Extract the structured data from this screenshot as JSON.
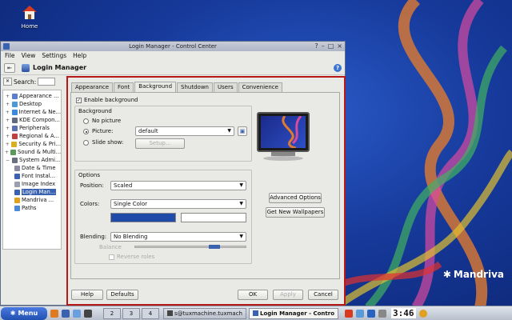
{
  "desktop": {
    "home_label": "Home",
    "brand": "Mandriva"
  },
  "window": {
    "title": "Login Manager - Control Center",
    "menu": [
      "File",
      "View",
      "Settings",
      "Help"
    ],
    "toolbar_title": "Login Manager",
    "search_label": "Search:"
  },
  "sidebar": {
    "items": [
      {
        "label": "Appearance ...",
        "expander": "+",
        "color": "#5a7fd0"
      },
      {
        "label": "Desktop",
        "expander": "+",
        "color": "#4a9ad8"
      },
      {
        "label": "Internet & Ne...",
        "expander": "+",
        "color": "#3a8ae0"
      },
      {
        "label": "KDE Compon...",
        "expander": "+",
        "color": "#606a80"
      },
      {
        "label": "Peripherals",
        "expander": "+",
        "color": "#5a70b0"
      },
      {
        "label": "Regional & A...",
        "expander": "+",
        "color": "#c04040"
      },
      {
        "label": "Security & Pri...",
        "expander": "+",
        "color": "#d8b020"
      },
      {
        "label": "Sound & Multi...",
        "expander": "+",
        "color": "#5a9a5a"
      },
      {
        "label": "System Admi...",
        "expander": "−",
        "color": "#6a7080"
      },
      {
        "label": "Date & Time",
        "expander": "",
        "color": "#8a8aa0"
      },
      {
        "label": "Font Instal...",
        "expander": "",
        "color": "#3a62b0"
      },
      {
        "label": "Image Index",
        "expander": "",
        "color": "#9aa0b0"
      },
      {
        "label": "Login Man...",
        "expander": "",
        "color": "#3a62b0",
        "selected": true
      },
      {
        "label": "Mandriva ...",
        "expander": "",
        "color": "#e0a020"
      },
      {
        "label": "Paths",
        "expander": "",
        "color": "#4a8ad8"
      }
    ]
  },
  "tabs": [
    "Appearance",
    "Font",
    "Background",
    "Shutdown",
    "Users",
    "Convenience"
  ],
  "background_tab": {
    "enable_label": "Enable background",
    "enabled": true,
    "group_title": "Background",
    "no_picture_label": "No picture",
    "picture_label": "Picture:",
    "picture_value": "default",
    "slide_show_label": "Slide show:",
    "setup_button": "Setup...",
    "options_title": "Options",
    "position_label": "Position:",
    "position_value": "Scaled",
    "colors_label": "Colors:",
    "colors_value": "Single Color",
    "color1": "#1f4aa8",
    "color2": "#ffffff",
    "blending_label": "Blending:",
    "blending_value": "No Blending",
    "balance_label": "Balance",
    "reverse_roles_label": "Reverse roles",
    "advanced_options_button": "Advanced Options",
    "new_wallpapers_button": "Get New Wallpapers"
  },
  "footer": {
    "help_button": "Help",
    "defaults_button": "Defaults",
    "ok_button": "OK",
    "apply_button": "Apply",
    "cancel_button": "Cancel"
  },
  "taskbar": {
    "menu_label": "Menu",
    "desktops": [
      "2",
      "3",
      "4"
    ],
    "tasks": [
      {
        "label": "s@tuxmachine.tuxmach",
        "active": false
      },
      {
        "label": "Login Manager - Contro",
        "active": true
      }
    ],
    "clock": "3:46"
  }
}
